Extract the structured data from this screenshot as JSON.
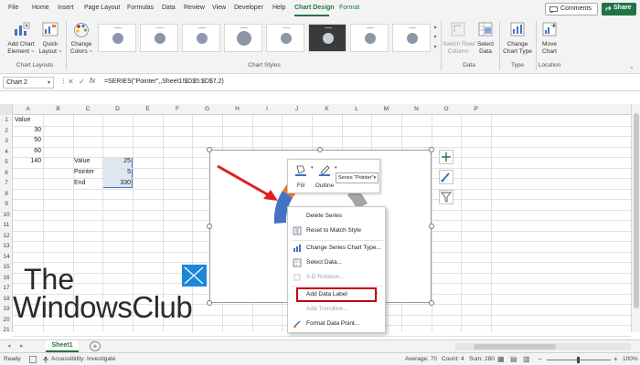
{
  "menu": {
    "tabs": [
      "File",
      "Home",
      "Insert",
      "Page Layout",
      "Formulas",
      "Data",
      "Review",
      "View",
      "Developer",
      "Help",
      "Chart Design",
      "Format"
    ],
    "comments_label": "Comments",
    "share_label": "Share"
  },
  "ribbon": {
    "add_chart_element": [
      "Add Chart",
      "Element ~"
    ],
    "quick_layout": [
      "Quick",
      "Layout ~"
    ],
    "change_colors": [
      "Change",
      "Colors ~"
    ],
    "chart_layouts_group": "Chart Layouts",
    "chart_styles_group": "Chart Styles",
    "switch_row_column": [
      "Switch Row/",
      "Column"
    ],
    "select_data": [
      "Select",
      "Data"
    ],
    "data_group": "Data",
    "change_chart_type": [
      "Change",
      "Chart Type"
    ],
    "type_group": "Type",
    "move_chart": [
      "Move",
      "Chart"
    ],
    "location_group": "Location"
  },
  "formula_bar": {
    "name_box": "Chart 2",
    "formula": "=SERIES(\"Pointer\",,Sheet1!$D$5:$D$7,2)"
  },
  "columns": [
    "A",
    "B",
    "C",
    "D",
    "E",
    "F",
    "G",
    "H",
    "I",
    "J",
    "K",
    "L",
    "M",
    "N",
    "O",
    "P"
  ],
  "rows": [
    "1",
    "2",
    "3",
    "4",
    "5",
    "6",
    "7",
    "8",
    "9",
    "10",
    "11",
    "12",
    "13",
    "14",
    "15",
    "16",
    "17",
    "18",
    "19",
    "20",
    "21"
  ],
  "cells": {
    "a1": "Value",
    "a2": "30",
    "a3": "50",
    "a4": "60",
    "a5": "140",
    "c5": "Value",
    "d5": "25",
    "c6": "Pointer",
    "d6": "5",
    "c7": "End",
    "d7": "330"
  },
  "mini_toolbar": {
    "fill_label": "Fill",
    "outline_label": "Outline",
    "series_select": "Series \"Pointer\""
  },
  "context_menu": {
    "items": [
      "Delete Series",
      "Reset to Match Style",
      "Change Series Chart Type...",
      "Select Data...",
      "3-D Rotation...",
      "Add Data Label",
      "Add Trendline...",
      "Format Data Point..."
    ]
  },
  "sheet_tab": "Sheet1",
  "status": {
    "ready": "Ready",
    "accessibility": "Accessibility: Investigate",
    "average": "Average: 70",
    "count": "Count: 4",
    "sum": "Sum: 280",
    "zoom": "100%"
  },
  "watermark": [
    "The",
    "WindowsClub"
  ],
  "colors": {
    "accent": "#217346",
    "highlight": "#c00000",
    "arrow": "#e02020",
    "pie_blue": "#4472c4",
    "pie_orange": "#ed7d31",
    "pie_gray": "#a5a5a5"
  }
}
